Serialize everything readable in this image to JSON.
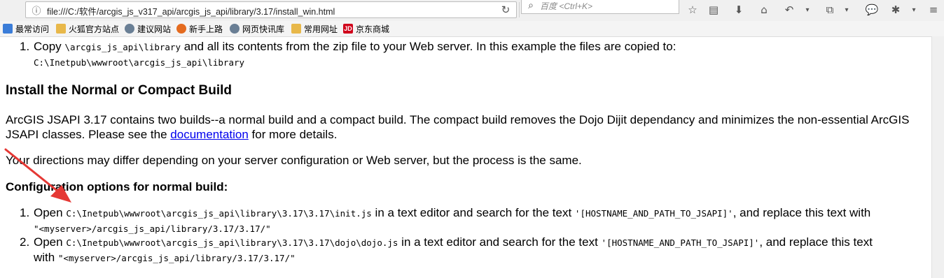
{
  "toolbar": {
    "url": "file:///C:/软件/arcgis_js_v317_api/arcgis_js_api/library/3.17/install_win.html",
    "search_placeholder": "百度 <Ctrl+K>"
  },
  "bookmarks": [
    {
      "label": "最常访问",
      "color": "#3b7dd8"
    },
    {
      "label": "火狐官方站点",
      "color": "#e8b84a"
    },
    {
      "label": "建议网站",
      "color": "#6a7f95"
    },
    {
      "label": "新手上路",
      "color": "#e46b1f"
    },
    {
      "label": "网页快讯库",
      "color": "#6a7f95"
    },
    {
      "label": "常用网址",
      "color": "#e8b84a"
    },
    {
      "label": "京东商城",
      "color": "#d0021b",
      "icon_text": "JD"
    }
  ],
  "content": {
    "step_copy": {
      "num": "1.",
      "pre": "Copy ",
      "code1": "\\arcgis_js_api\\library",
      "post": " and all its contents from the zip file to your Web server. In this example the files are copied to:",
      "code2": "C:\\Inetpub\\wwwroot\\arcgis_js_api\\library"
    },
    "heading": "Install the Normal or Compact Build",
    "para1_line1": "ArcGIS JSAPI 3.17 contains two builds--a normal build and a compact build. The compact build removes the Dojo Dijit dependancy and minimizes the non-essential ArcGIS",
    "para1_line2_pre": "JSAPI classes. Please see the ",
    "para1_link": "documentation",
    "para1_line2_post": " for more details.",
    "para2": "Your directions may differ depending on your server configuration or Web server, but the process is the same.",
    "subheading": "Configuration options for normal build:",
    "step1": {
      "num": "1.",
      "pre": "Open ",
      "code": "C:\\Inetpub\\wwwroot\\arcgis_js_api\\library\\3.17\\3.17\\init.js",
      "mid": " in a text editor and search for the text ",
      "token": "'[HOSTNAME_AND_PATH_TO_JSAPI]'",
      "post": ", and replace this text with",
      "value": "\"<myserver>/arcgis_js_api/library/3.17/3.17/\""
    },
    "step2": {
      "num": "2.",
      "pre": "Open ",
      "code": "C:\\Inetpub\\wwwroot\\arcgis_js_api\\library\\3.17\\3.17\\dojo\\dojo.js",
      "mid": " in a text editor and search for the text ",
      "token": "'[HOSTNAME_AND_PATH_TO_JSAPI]'",
      "post": ", and replace this text",
      "line2_pre": "with ",
      "value": "\"<myserver>/arcgis_js_api/library/3.17/3.17/\""
    }
  },
  "colors": {
    "link": "#0000ee",
    "arrow": "#e53935"
  }
}
